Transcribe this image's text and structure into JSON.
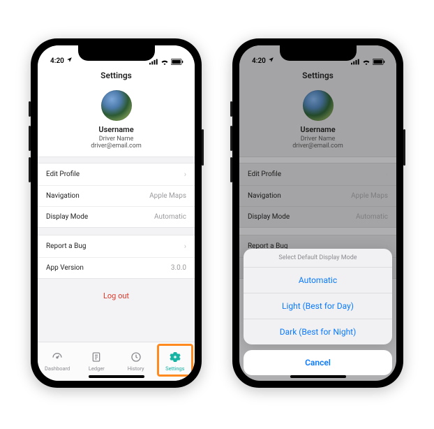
{
  "status": {
    "time": "4:20",
    "loc_icon": "location-icon",
    "signal_icon": "signal-icon",
    "wifi_icon": "wifi-icon",
    "battery_icon": "battery-icon"
  },
  "header": {
    "title": "Settings"
  },
  "profile": {
    "username": "Username",
    "driver": "Driver Name",
    "email": "driver@email.com"
  },
  "group1": {
    "edit_profile": {
      "label": "Edit Profile"
    },
    "navigation": {
      "label": "Navigation",
      "value": "Apple Maps"
    },
    "display_mode": {
      "label": "Display Mode",
      "value": "Automatic"
    }
  },
  "group2": {
    "report_bug": {
      "label": "Report a Bug"
    },
    "app_version": {
      "label": "App Version",
      "value": "3.0.0"
    }
  },
  "logout_label": "Log out",
  "tabs": {
    "dashboard": "Dashboard",
    "ledger": "Ledger",
    "history": "History",
    "settings": "Settings"
  },
  "sheet": {
    "title": "Select Default Display Mode",
    "opt1": "Automatic",
    "opt2": "Light (Best for Day)",
    "opt3": "Dark (Best for Night)",
    "cancel": "Cancel"
  }
}
